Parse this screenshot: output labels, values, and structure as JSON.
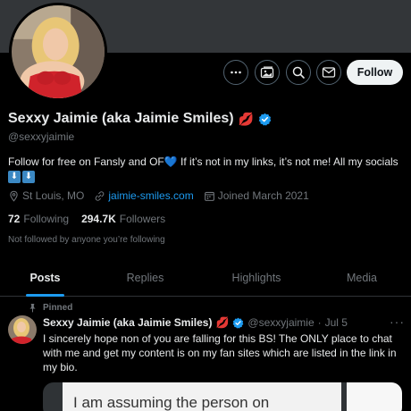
{
  "profile": {
    "display_name": "Sexxy Jaimie (aka Jaimie Smiles)",
    "name_emoji": "💋",
    "handle": "@sexxyjaimie",
    "bio_text": "Follow for free on Fansly and OF",
    "bio_heart": "💙",
    "bio_text2": " If it’s not in my links, it’s not me! All my socials ",
    "bio_arrows": [
      "⬇",
      "⬇"
    ],
    "location": "St Louis, MO",
    "website": "jaimie-smiles.com",
    "joined": "Joined March 2021",
    "following_count": "72",
    "following_label": "Following",
    "followers_count": "294.7K",
    "followers_label": "Followers",
    "not_followed_text": "Not followed by anyone you’re following"
  },
  "actions": {
    "more_icon": "more-icon",
    "media_icon": "media-gallery-icon",
    "search_icon": "search-icon",
    "message_icon": "message-icon",
    "follow_label": "Follow"
  },
  "tabs": [
    {
      "label": "Posts",
      "active": true
    },
    {
      "label": "Replies",
      "active": false
    },
    {
      "label": "Highlights",
      "active": false
    },
    {
      "label": "Media",
      "active": false
    }
  ],
  "pinned_tweet": {
    "pinned_label": "Pinned",
    "author_name": "Sexxy Jaimie (aka Jaimie Smiles)",
    "author_emoji": "💋",
    "author_handle": "@sexxyjaimie",
    "separator": "·",
    "date": "Jul 5",
    "more_label": "···",
    "text": "I sincerely hope non of you are falling for this BS! The ONLY place to chat with me and get my content is on my fan sites which are listed in the link in my bio.",
    "media_text": "I am assuming the person on"
  },
  "colors": {
    "accent": "#1d9bf0",
    "verified": "#1d9bf0",
    "secondary_text": "#71767b",
    "background": "#000000",
    "banner": "#333639"
  }
}
